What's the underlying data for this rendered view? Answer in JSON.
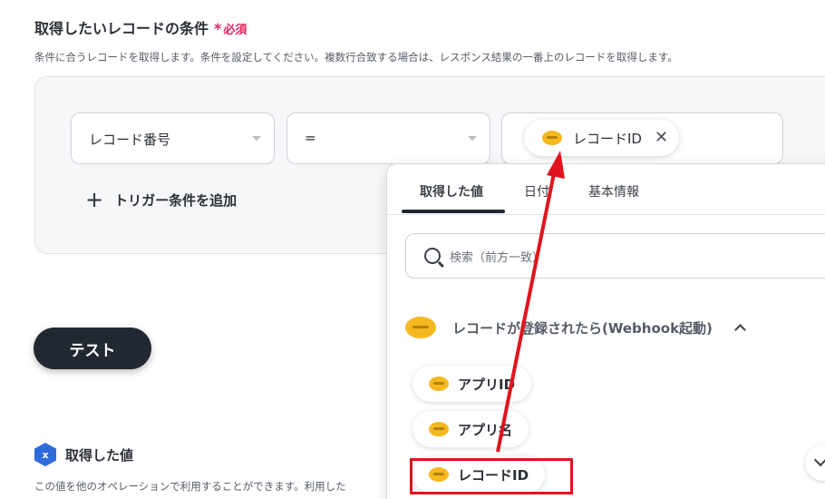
{
  "condition_section": {
    "title": "取得したいレコードの条件",
    "required_mark": "*",
    "required_label": "必須",
    "description": "条件に合うレコードを取得します。条件を設定してください。複数行合致する場合は、レスポンス結果の一番上のレコードを取得します。",
    "field_select": "レコード番号",
    "operator_select": "=",
    "value_chip": {
      "icon": "kintone-icon",
      "label": "レコードID",
      "close": "✕"
    },
    "add_trigger_label": "トリガー条件を追加"
  },
  "test_button": "テスト",
  "obtained": {
    "icon_letter": "x",
    "title": "取得した値",
    "description": "この値を他のオペレーションで利用することができます。利用した"
  },
  "picker": {
    "tabs": [
      {
        "label": "取得した値",
        "active": true
      },
      {
        "label": "日付",
        "active": false
      },
      {
        "label": "基本情報",
        "active": false
      }
    ],
    "search_placeholder": "検索（前方一致）",
    "group": {
      "title": "レコードが登録されたら(Webhook起動)",
      "expanded": true
    },
    "items": [
      {
        "label": "アプリID"
      },
      {
        "label": "アプリ名"
      },
      {
        "label": "レコードID",
        "highlighted": true
      }
    ]
  },
  "colors": {
    "accent_required": "#e0245e",
    "highlight_box": "#e0141e",
    "annotation_arrow": "#e0141e",
    "kintone_yellow": "#f5b81f"
  }
}
